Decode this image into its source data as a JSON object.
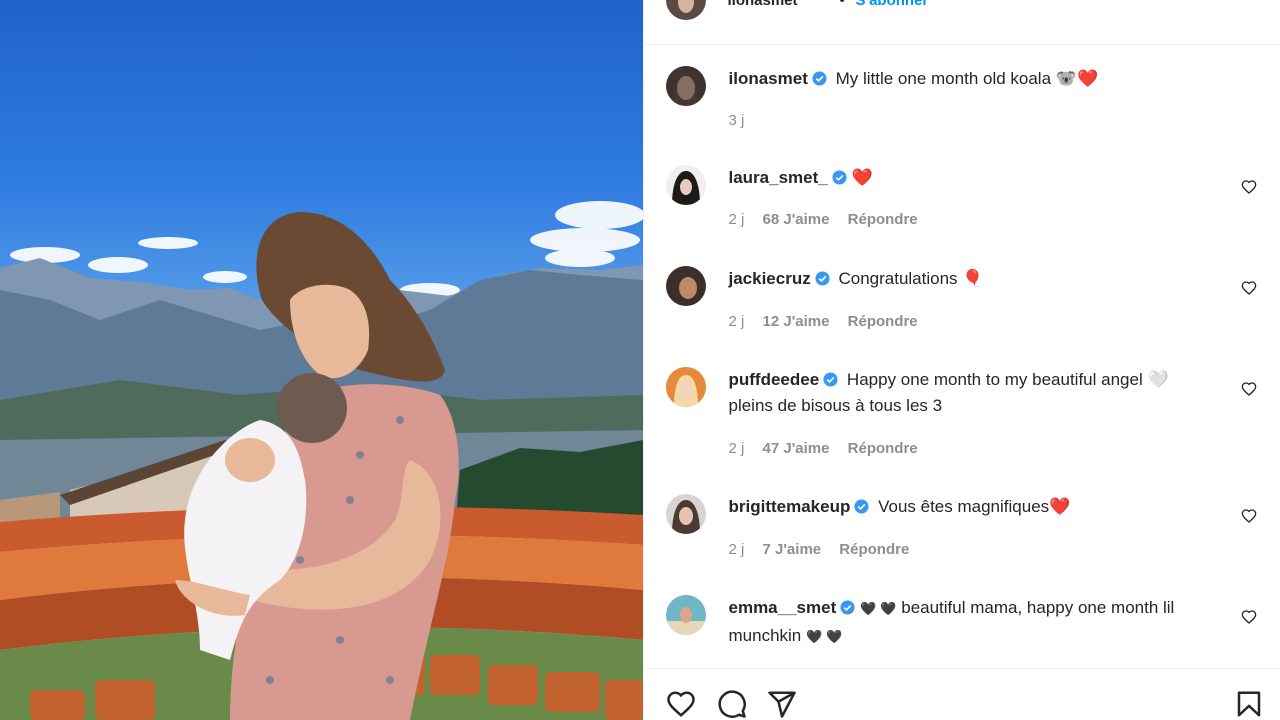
{
  "post": {
    "header": {
      "username": "ilonasmet",
      "separator": "•",
      "follow_label": "S'abonner",
      "more_icon": "more-icon"
    },
    "caption": {
      "username": "ilonasmet",
      "text": "My little one month old koala",
      "emoji": "🐨❤️",
      "time": "3 j"
    },
    "comments": [
      {
        "username": "laura_smet_",
        "verified": true,
        "text": "",
        "emoji": "❤️",
        "time": "2 j",
        "likes": "68 J'aime",
        "reply": "Répondre"
      },
      {
        "username": "jackiecruz",
        "verified": true,
        "text": "Congratulations",
        "emoji": "🎈",
        "time": "2 j",
        "likes": "12 J'aime",
        "reply": "Répondre"
      },
      {
        "username": "puffdeedee",
        "verified": true,
        "text": "Happy one month to my beautiful angel",
        "emoji": "🤍",
        "text2": "pleins de bisous à tous les 3",
        "time": "2 j",
        "likes": "47 J'aime",
        "reply": "Répondre"
      },
      {
        "username": "brigittemakeup",
        "verified": true,
        "text": "Vous êtes magnifiques",
        "emoji": "❤️",
        "time": "2 j",
        "likes": "7 J'aime",
        "reply": "Répondre"
      },
      {
        "username": "emma__smet",
        "verified": true,
        "emoji_lead": "🖤 🖤",
        "text": "beautiful mama, happy one month lil",
        "text2": "munchkin",
        "emoji_trail": "🖤 🖤"
      }
    ],
    "actions": [
      "like-icon",
      "comment-icon",
      "share-icon",
      "save-icon"
    ],
    "colors": {
      "accent": "#0095f6",
      "verified": "#3897f0",
      "muted": "#8e8e8e",
      "like_red": "#ed4956"
    }
  }
}
